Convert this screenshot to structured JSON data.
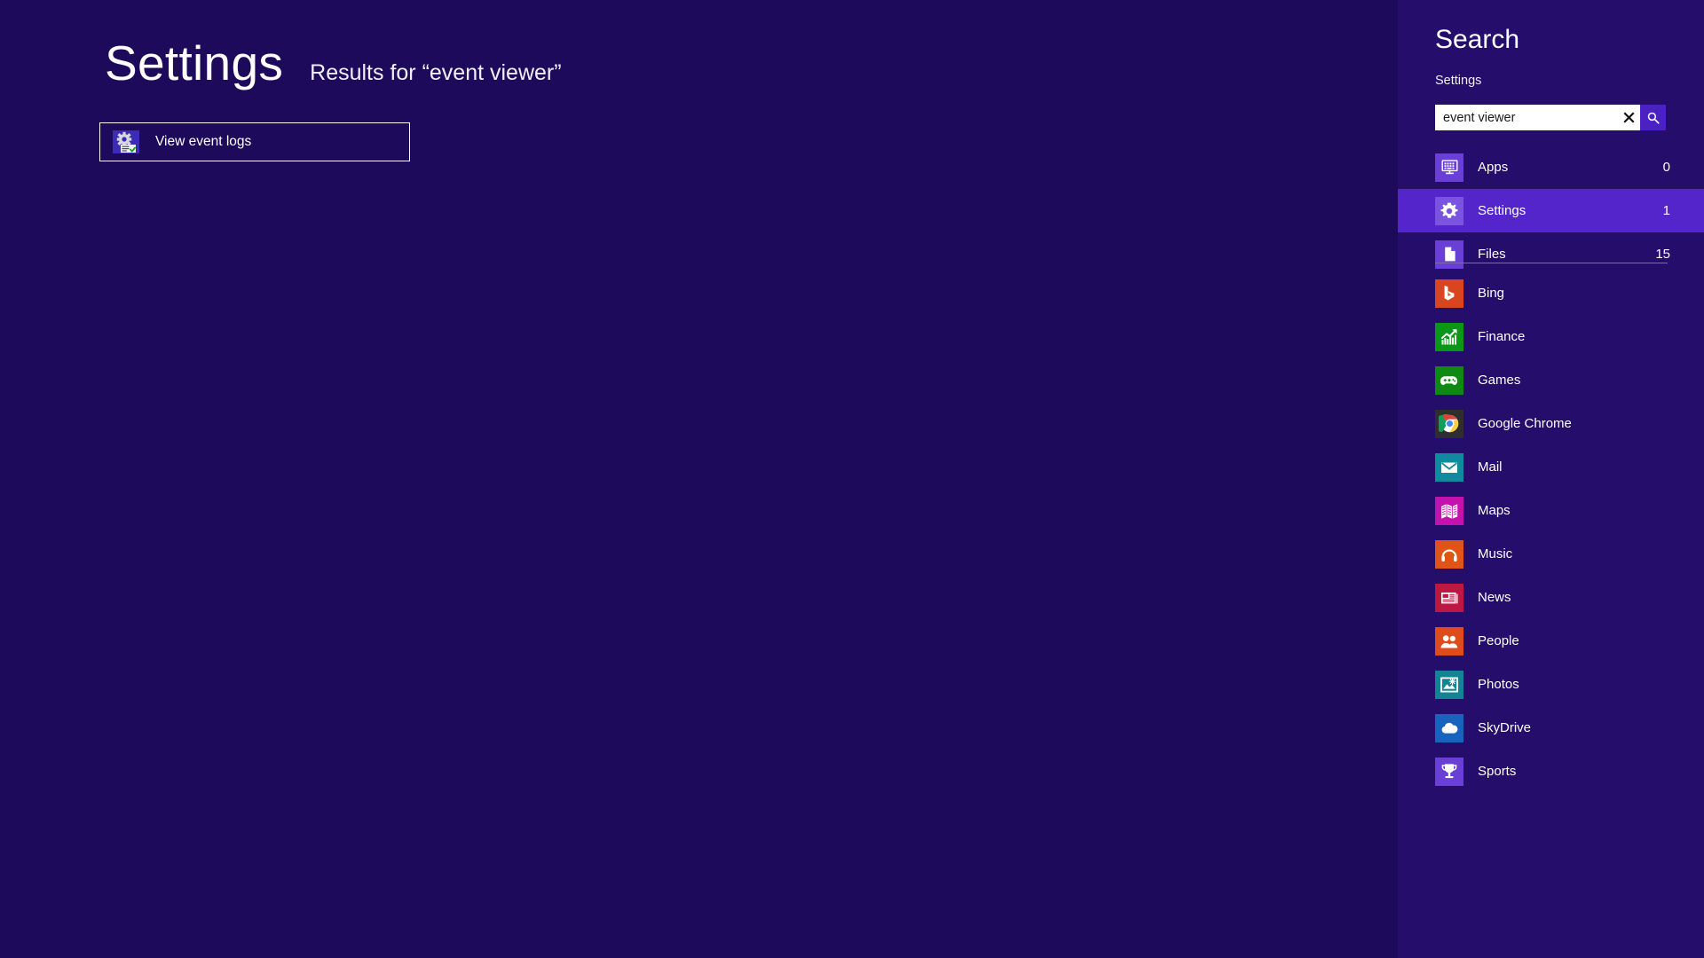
{
  "results": {
    "title": "Settings",
    "subtitle": "Results for “event viewer”",
    "items": [
      {
        "label": "View event logs",
        "icon": "control-panel-gear-icon"
      }
    ]
  },
  "search_panel": {
    "heading": "Search",
    "scope_label": "Settings",
    "search_input": {
      "value": "event viewer",
      "placeholder": "Search"
    },
    "clear_label": "✕",
    "submit_icon": "magnifier-icon",
    "scopes": [
      {
        "label": "Apps",
        "count": "0",
        "icon": "apps-monitor-icon",
        "selected": false
      },
      {
        "label": "Settings",
        "count": "1",
        "icon": "gear-icon",
        "selected": true
      },
      {
        "label": "Files",
        "count": "15",
        "icon": "document-icon",
        "selected": false
      }
    ],
    "apps": [
      {
        "label": "Bing",
        "icon": "bing-icon",
        "color": "#D8451F"
      },
      {
        "label": "Finance",
        "icon": "finance-icon",
        "color": "#0C9618"
      },
      {
        "label": "Games",
        "icon": "games-icon",
        "color": "#0E8A14"
      },
      {
        "label": "Google Chrome",
        "icon": "chrome-icon",
        "color": "#2E2E2E"
      },
      {
        "label": "Mail",
        "icon": "mail-icon",
        "color": "#108A9E"
      },
      {
        "label": "Maps",
        "icon": "maps-icon",
        "color": "#C312AE"
      },
      {
        "label": "Music",
        "icon": "music-icon",
        "color": "#E15418"
      },
      {
        "label": "News",
        "icon": "news-icon",
        "color": "#BF1743"
      },
      {
        "label": "People",
        "icon": "people-icon",
        "color": "#DE4C1B"
      },
      {
        "label": "Photos",
        "icon": "photos-icon",
        "color": "#128494"
      },
      {
        "label": "SkyDrive",
        "icon": "skydrive-icon",
        "color": "#1763BD"
      },
      {
        "label": "Sports",
        "icon": "sports-icon",
        "color": "#6A3FD6"
      }
    ]
  },
  "colors": {
    "background": "#1e0a5a",
    "panel": "#240d6b",
    "accent": "#5425cb",
    "submit_button": "#4b21c4"
  }
}
